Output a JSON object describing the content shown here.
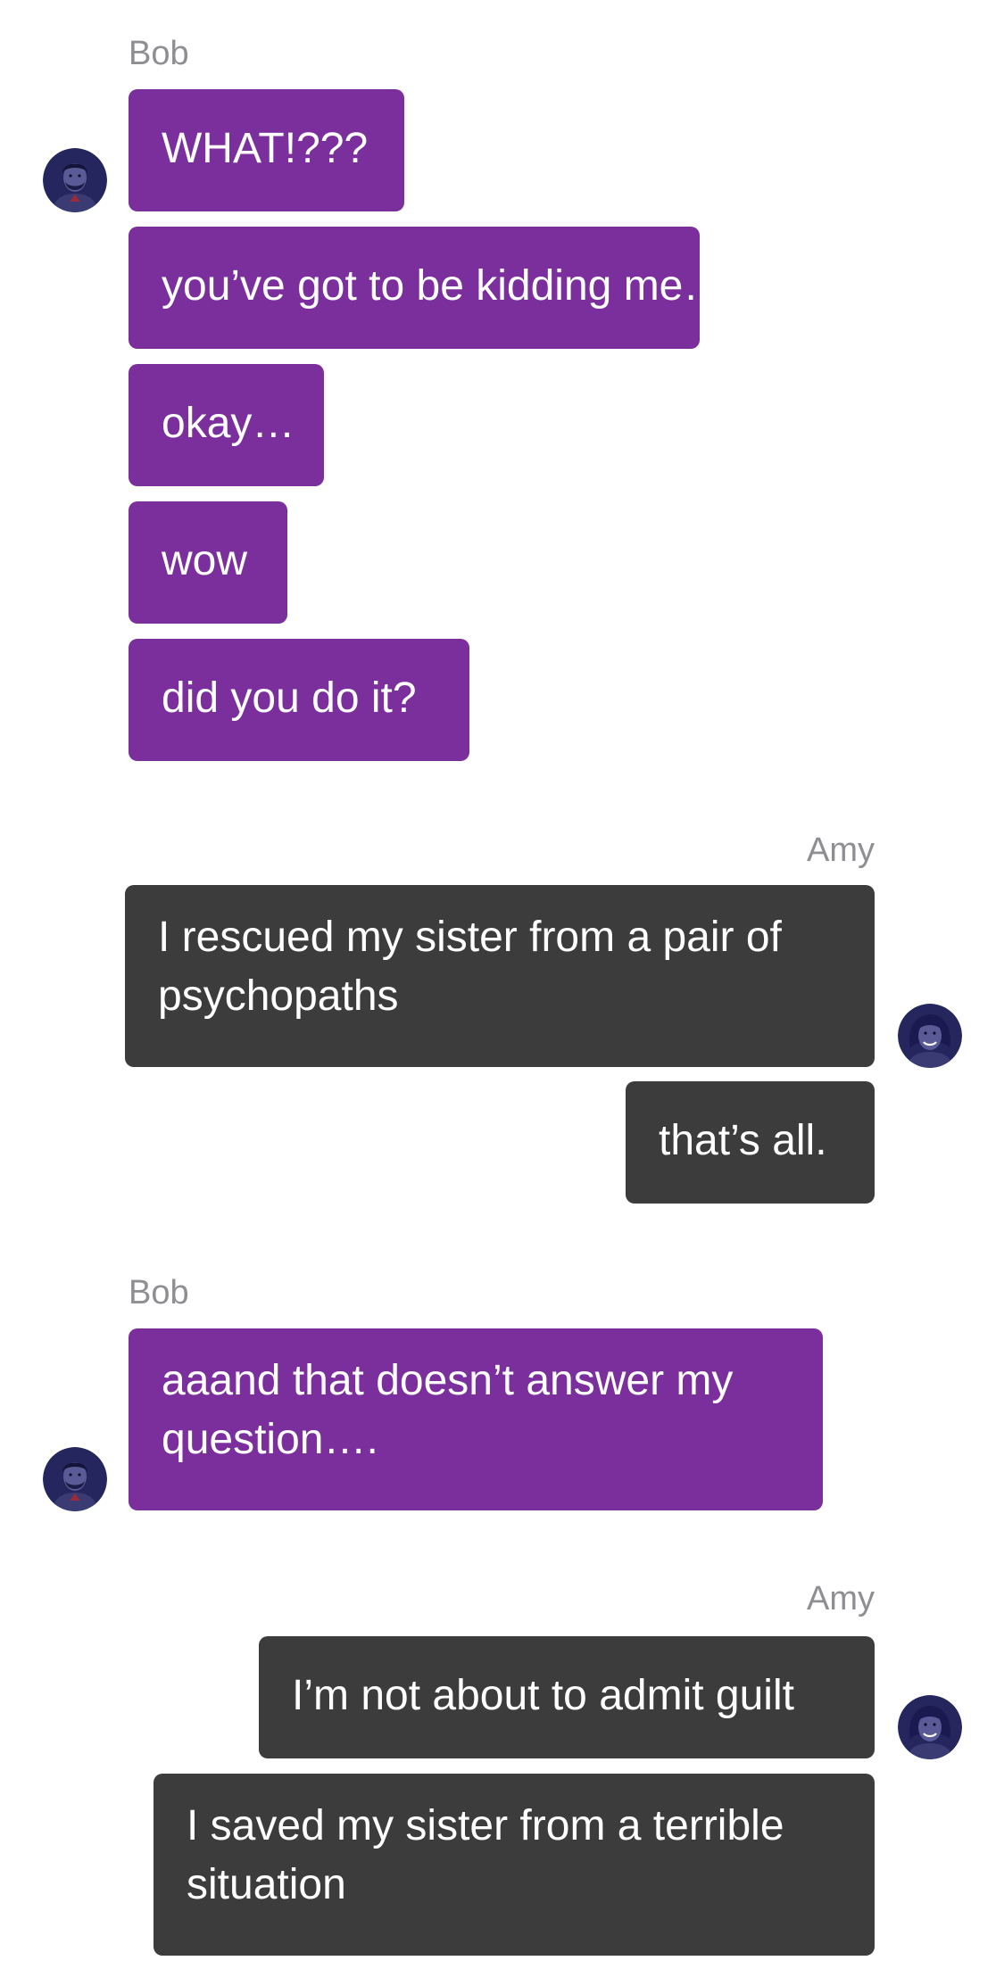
{
  "conversation": {
    "groups": [
      {
        "sender": "Bob",
        "side": "left",
        "avatar_icon": "male-avatar-icon",
        "messages": [
          "WHAT!???",
          "you’ve got to be kidding me…",
          "okay…",
          "wow",
          "did you do it?"
        ]
      },
      {
        "sender": "Amy",
        "side": "right",
        "avatar_icon": "female-avatar-icon",
        "messages": [
          "I rescued my sister from a pair of psychopaths",
          "that’s all."
        ]
      },
      {
        "sender": "Bob",
        "side": "left",
        "avatar_icon": "male-avatar-icon",
        "messages": [
          "aaand that doesn’t answer my question…."
        ]
      },
      {
        "sender": "Amy",
        "side": "right",
        "avatar_icon": "female-avatar-icon",
        "messages": [
          "I’m not about to admit guilt",
          "I saved my sister from a terrible situation"
        ]
      }
    ]
  },
  "colors": {
    "bob_bubble": "#7b2f9c",
    "amy_bubble": "#3c3c3c",
    "sender_name": "#8e8e93",
    "message_text": "#ffffff",
    "avatar_background": "#26265e"
  }
}
